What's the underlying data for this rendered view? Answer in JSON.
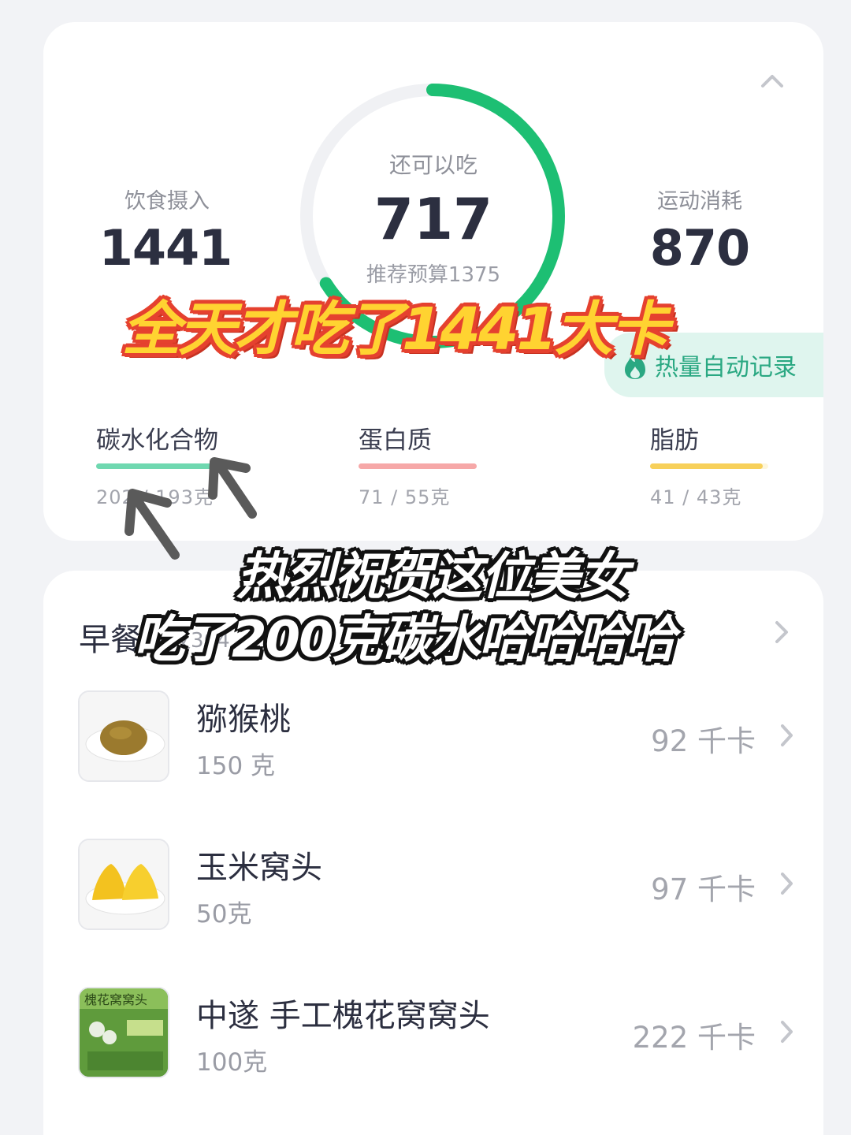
{
  "summary": {
    "intake_label": "饮食摄入",
    "intake_value": "1441",
    "remaining_label": "还可以吃",
    "remaining_value": "717",
    "budget_text": "推荐预算1375",
    "exercise_label": "运动消耗",
    "exercise_value": "870",
    "ring_progress": 0.66,
    "ring_color": "#1dbf73",
    "auto_record_label": "热量自动记录"
  },
  "macros": [
    {
      "name": "碳水化合物",
      "amount": "202 / 193克",
      "color": "#6fd8b0",
      "progress": 1.0
    },
    {
      "name": "蛋白质",
      "amount": "71 / 55克",
      "color": "#f6a8a8",
      "progress": 1.0
    },
    {
      "name": "脂肪",
      "amount": "41 / 43克",
      "color": "#f7d05a",
      "progress": 0.95
    }
  ],
  "meal": {
    "title": "早餐",
    "subtitle": "建议364"
  },
  "foods": [
    {
      "name": "猕猴桃",
      "amount": "150 克",
      "kcal": "92 千卡"
    },
    {
      "name": "玉米窝头",
      "amount": "50克",
      "kcal": "97 千卡"
    },
    {
      "name": "中遂 手工槐花窝窝头",
      "amount": "100克",
      "kcal": "222 千卡",
      "package_text": "槐花窝窝头"
    }
  ],
  "overlay": {
    "caption_1": "全天才吃了1441大卡",
    "caption_2_line1": "热烈祝贺这位美女",
    "caption_2_line2": "吃了200克碳水哈哈哈哈"
  }
}
